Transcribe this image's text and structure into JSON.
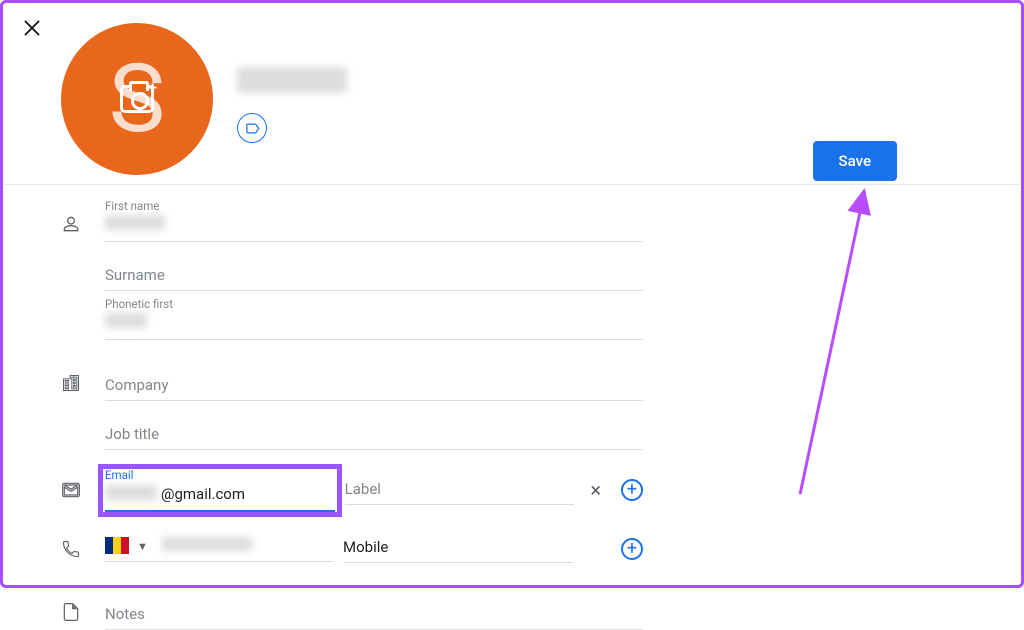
{
  "buttons": {
    "save": "Save"
  },
  "avatar": {
    "initial": "S"
  },
  "labels": {
    "first_name": "First name",
    "surname": "Surname",
    "phonetic_first": "Phonetic first",
    "company": "Company",
    "job_title": "Job title",
    "email": "Email",
    "email_label_ph": "Label",
    "phone_label": "Mobile",
    "notes": "Notes"
  },
  "values": {
    "email_suffix": "@gmail.com"
  }
}
